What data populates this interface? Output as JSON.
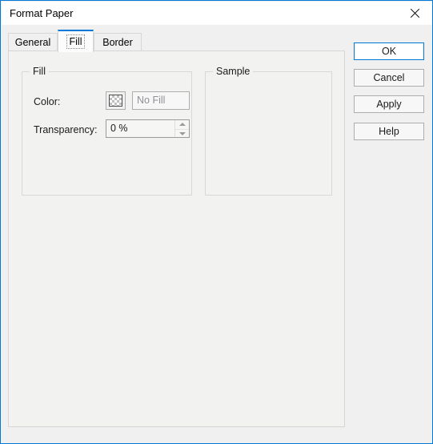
{
  "window": {
    "title": "Format Paper",
    "close_icon": "close-icon",
    "border_color": "#0078d7"
  },
  "tabs": {
    "items": [
      {
        "label": "General",
        "active": false
      },
      {
        "label": "Fill",
        "active": true
      },
      {
        "label": "Border",
        "active": false
      }
    ],
    "active_index": 1,
    "active_accent": "#0078d7"
  },
  "fill_group": {
    "title": "Fill",
    "color": {
      "label": "Color:",
      "swatch_icon": "transparent-checkerboard-swatch",
      "value": "No Fill"
    },
    "transparency": {
      "label": "Transparency:",
      "value": "0 %",
      "up_icon": "spinner-up-icon",
      "down_icon": "spinner-down-icon"
    }
  },
  "sample_group": {
    "title": "Sample"
  },
  "buttons": {
    "ok": "OK",
    "cancel": "Cancel",
    "apply": "Apply",
    "help": "Help"
  }
}
